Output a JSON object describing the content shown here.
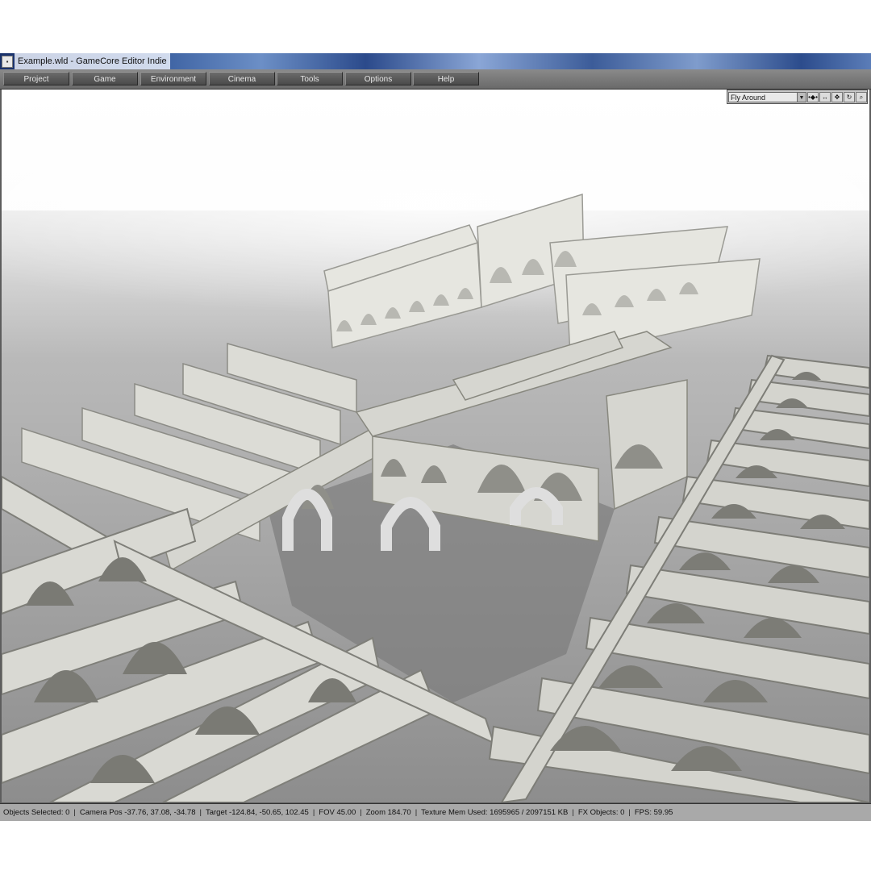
{
  "window": {
    "title": "Example.wld - GameCore Editor Indie"
  },
  "menu": [
    {
      "label": "Project"
    },
    {
      "label": "Game"
    },
    {
      "label": "Environment"
    },
    {
      "label": "Cinema"
    },
    {
      "label": "Tools"
    },
    {
      "label": "Options"
    },
    {
      "label": "Help"
    }
  ],
  "viewport_toolbar": {
    "camera_mode": "Fly Around",
    "icons": [
      "dropdown-arrow-icon",
      "move-points-icon",
      "pan-horizontal-icon",
      "move-all-icon",
      "rotate-icon",
      "zoom-icon"
    ]
  },
  "status": {
    "objects_selected": "Objects Selected: 0",
    "camera_pos": "Camera Pos -37.76, 37.08, -34.78",
    "target": "Target -124.84, -50.65, 102.45",
    "fov": "FOV 45.00",
    "zoom": "Zoom 184.70",
    "texture_mem": "Texture Mem Used: 1695965 / 2097151 KB",
    "fx_objects": "FX Objects: 0",
    "fps": "FPS: 59.95"
  },
  "colors": {
    "menubar": "#6a6a6a",
    "statusbar": "#a9a9a9",
    "floor": "#a8a8a8",
    "sky": "#ffffff",
    "walls": "#e2e2dc"
  }
}
